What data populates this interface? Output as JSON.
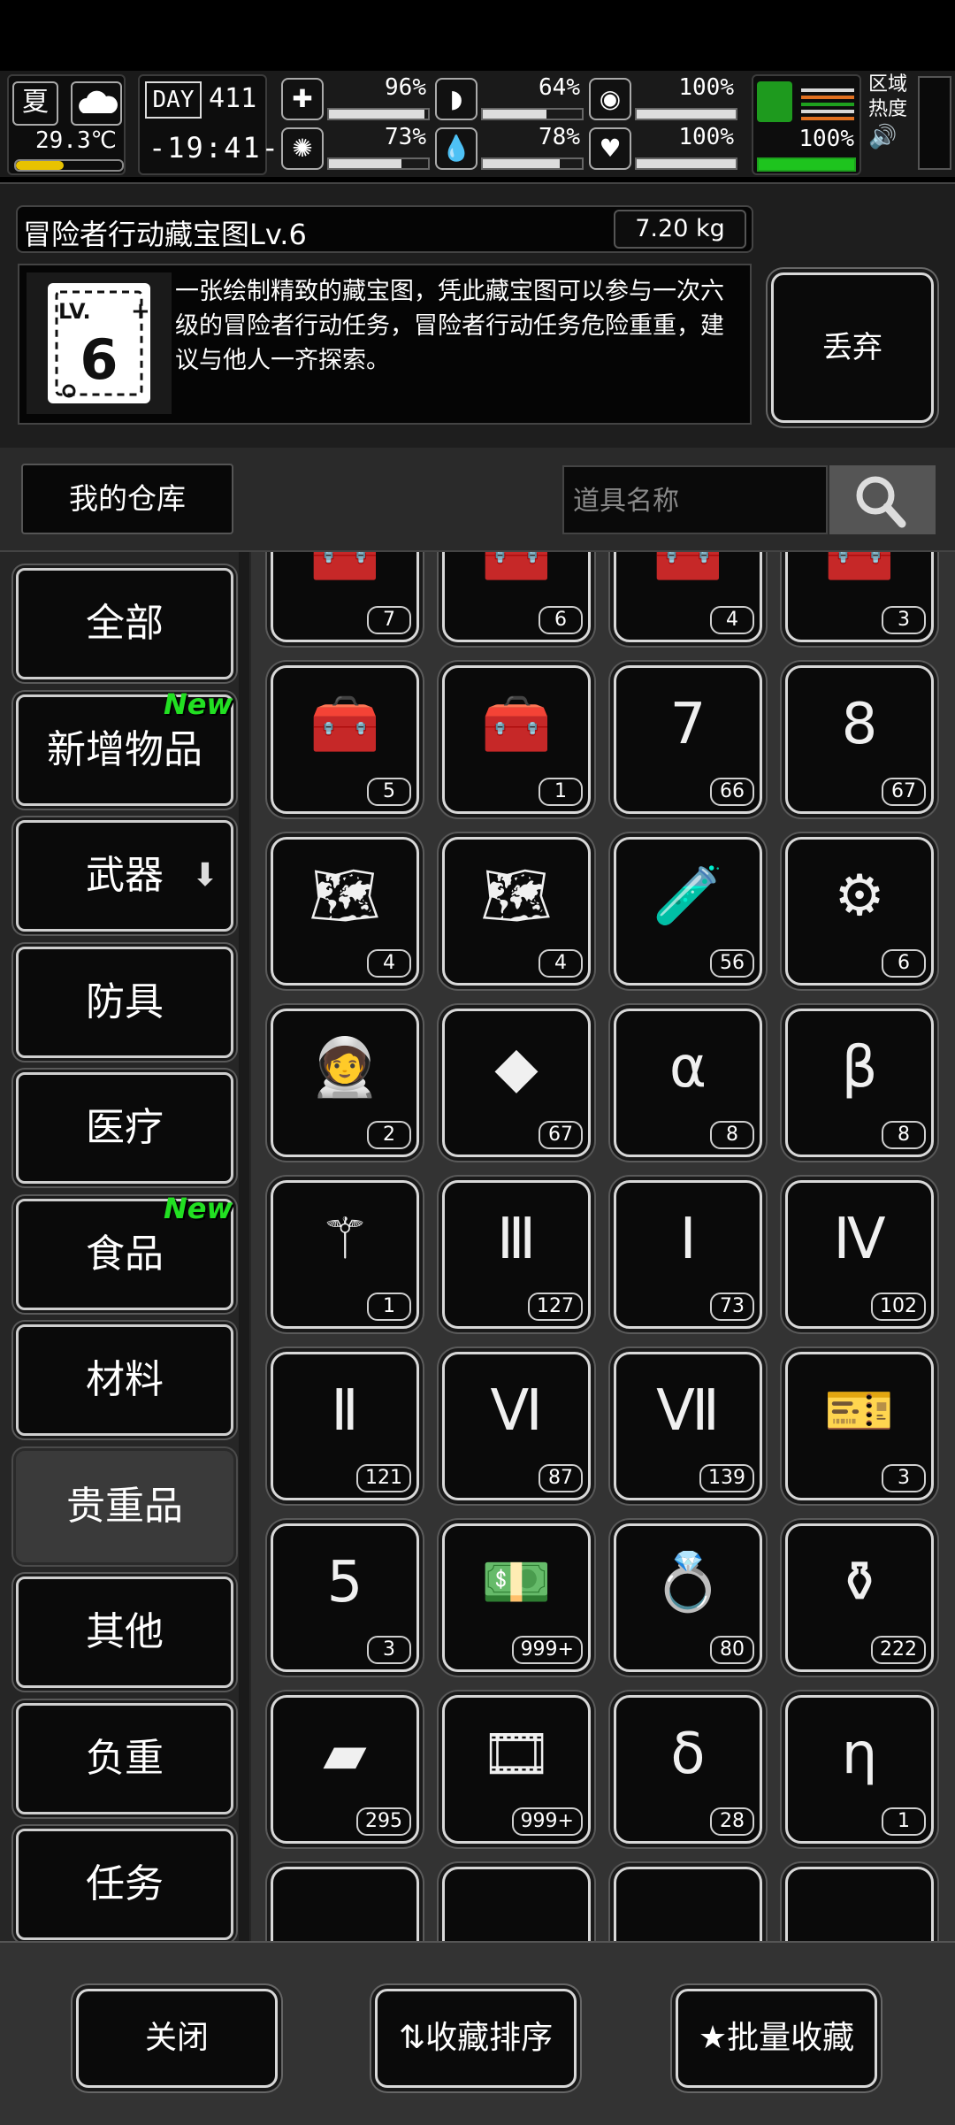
{
  "status": {
    "season": "夏",
    "temperature": "29.3℃",
    "temp_fill": 0.45,
    "day_label": "DAY",
    "day_number": "411",
    "clock": "-19:41-",
    "stats": [
      {
        "icon": "first-aid-icon",
        "glyph": "✚",
        "value": "96%",
        "fill": 0.96
      },
      {
        "icon": "stomach-icon",
        "glyph": "◗",
        "value": "64%",
        "fill": 0.64
      },
      {
        "icon": "bladder-icon",
        "glyph": "◉",
        "value": "100%",
        "fill": 1.0
      },
      {
        "icon": "brain-icon",
        "glyph": "✺",
        "value": "73%",
        "fill": 0.73
      },
      {
        "icon": "water-drop-icon",
        "glyph": "💧",
        "value": "78%",
        "fill": 0.78
      },
      {
        "icon": "heart-icon",
        "glyph": "♥",
        "value": "100%",
        "fill": 1.0
      }
    ],
    "stamina": "100%",
    "stamina_fill": 1.0,
    "area_label": "区域热度"
  },
  "item": {
    "name": "冒险者行动藏宝图Lv.6",
    "weight": "7.20 kg",
    "thumb_level": "6",
    "description": "一张绘制精致的藏宝图，凭此藏宝图可以参与一次六级的冒险者行动任务，冒险者行动任务危险重重，建议与他人一齐探索。",
    "discard_label": "丢弃"
  },
  "warehouse": {
    "label": "我的仓库",
    "search_placeholder": "道具名称"
  },
  "categories": [
    {
      "label": "全部",
      "new": ""
    },
    {
      "label": "新增物品",
      "new": "New"
    },
    {
      "label": "武器",
      "new": ""
    },
    {
      "label": "防具",
      "new": ""
    },
    {
      "label": "医疗",
      "new": ""
    },
    {
      "label": "食品",
      "new": "New"
    },
    {
      "label": "材料",
      "new": ""
    },
    {
      "label": "贵重品",
      "new": ""
    },
    {
      "label": "其他",
      "new": ""
    },
    {
      "label": "负重",
      "new": ""
    },
    {
      "label": "任务",
      "new": ""
    }
  ],
  "selected_category": "贵重品",
  "grid": [
    {
      "icon": "toolbox-stack-icon",
      "glyph": "🧰",
      "count": "7"
    },
    {
      "icon": "toolbox-stack-icon",
      "glyph": "🧰",
      "count": "6"
    },
    {
      "icon": "toolbox-stack-icon",
      "glyph": "🧰",
      "count": "4"
    },
    {
      "icon": "toolbox-stack-icon",
      "glyph": "🧰",
      "count": "3"
    },
    {
      "icon": "toolbox-stack-icon",
      "glyph": "🧰",
      "count": "5"
    },
    {
      "icon": "toolbox-stack-icon",
      "glyph": "🧰",
      "count": "1"
    },
    {
      "icon": "treasure-map-lv7-icon",
      "glyph": "7",
      "count": "66"
    },
    {
      "icon": "treasure-map-lv8-icon",
      "glyph": "8",
      "count": "67"
    },
    {
      "icon": "map-lv2-icon",
      "glyph": "🗺",
      "count": "4"
    },
    {
      "icon": "map-lv1-icon",
      "glyph": "🗺",
      "count": "4"
    },
    {
      "icon": "test-tube-v-icon",
      "glyph": "🧪",
      "count": "56"
    },
    {
      "icon": "broken-device-icon",
      "glyph": "⚙",
      "count": "6"
    },
    {
      "icon": "astronaut-icon",
      "glyph": "🧑‍🚀",
      "count": "2"
    },
    {
      "icon": "yellow-crystal-icon",
      "glyph": "◆",
      "count": "67"
    },
    {
      "icon": "test-tube-alpha-icon",
      "glyph": "α",
      "count": "8"
    },
    {
      "icon": "test-tube-beta-icon",
      "glyph": "β",
      "count": "8"
    },
    {
      "icon": "scepter-icon",
      "glyph": "⚚",
      "count": "1"
    },
    {
      "icon": "test-tube-iii-icon",
      "glyph": "Ⅲ",
      "count": "127"
    },
    {
      "icon": "test-tube-i-icon",
      "glyph": "Ⅰ",
      "count": "73"
    },
    {
      "icon": "test-tube-iv-icon",
      "glyph": "Ⅳ",
      "count": "102"
    },
    {
      "icon": "test-tube-ii-icon",
      "glyph": "Ⅱ",
      "count": "121"
    },
    {
      "icon": "test-tube-vi-icon",
      "glyph": "Ⅵ",
      "count": "87"
    },
    {
      "icon": "test-tube-vii-icon",
      "glyph": "Ⅶ",
      "count": "139"
    },
    {
      "icon": "ticket-icon",
      "glyph": "🎫",
      "count": "3"
    },
    {
      "icon": "treasure-map-lv5-icon",
      "glyph": "5",
      "count": "3"
    },
    {
      "icon": "cash-stack-icon",
      "glyph": "💵",
      "count": "999+"
    },
    {
      "icon": "ring-icon",
      "glyph": "💍",
      "count": "80"
    },
    {
      "icon": "vase-icon",
      "glyph": "⚱",
      "count": "222"
    },
    {
      "icon": "gold-bar-icon",
      "glyph": "▰",
      "count": "295"
    },
    {
      "icon": "film-card-icon",
      "glyph": "🎞",
      "count": "999+"
    },
    {
      "icon": "test-tube-delta-icon",
      "glyph": "δ",
      "count": "28"
    },
    {
      "icon": "test-tube-eta-icon",
      "glyph": "η",
      "count": "1"
    },
    {
      "icon": "partial-item-icon",
      "glyph": "",
      "count": ""
    },
    {
      "icon": "partial-item-icon",
      "glyph": "",
      "count": ""
    },
    {
      "icon": "partial-item-icon",
      "glyph": "",
      "count": ""
    },
    {
      "icon": "partial-item-icon",
      "glyph": "",
      "count": ""
    }
  ],
  "bottom": {
    "close_label": "关闭",
    "sort_label": "收藏排序",
    "batch_label": "批量收藏"
  }
}
